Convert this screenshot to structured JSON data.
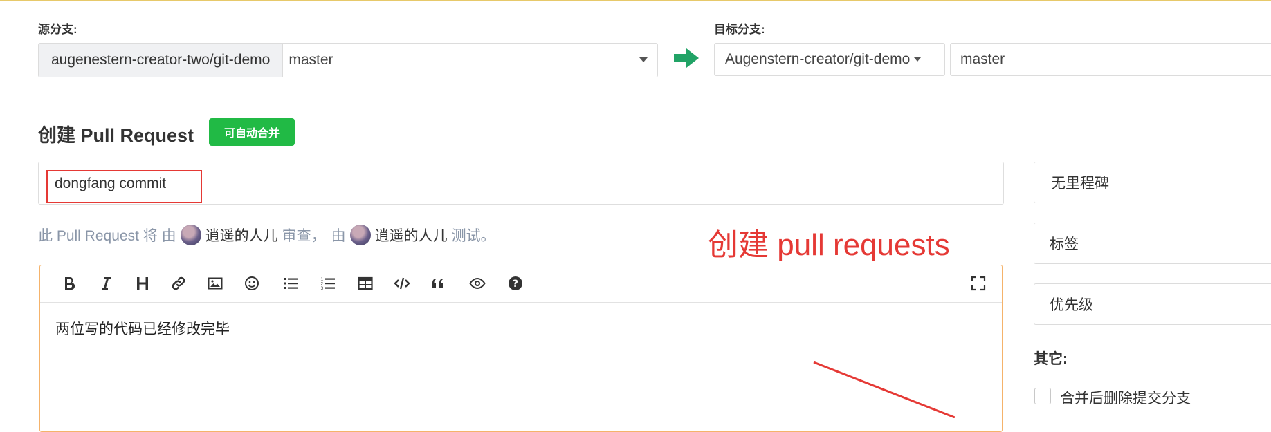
{
  "source": {
    "label": "源分支:",
    "repo": "augenestern-creator-two/git-demo",
    "branch": "master"
  },
  "target": {
    "label": "目标分支:",
    "repo": "Augenstern-creator/git-demo",
    "branch": "master"
  },
  "heading": {
    "title": "创建 Pull Request",
    "badge": "可自动合并"
  },
  "title_input": {
    "value": "dongfang commit"
  },
  "review": {
    "prefix": "此 Pull Request 将 由",
    "reviewer": "逍遥的人儿",
    "review_word": "审查，",
    "by": "由",
    "tester": "逍遥的人儿",
    "test_word": "测试。"
  },
  "annotation": {
    "text": "创建 pull requests",
    "color": "#e53935"
  },
  "editor": {
    "toolbar": [
      "bold-icon",
      "italic-icon",
      "heading-icon",
      "link-icon",
      "image-icon",
      "emoji-icon",
      "bullet-list-icon",
      "numbered-list-icon",
      "table-icon",
      "code-icon",
      "quote-icon",
      "preview-icon",
      "help-icon",
      "fullscreen-icon"
    ],
    "content": "两位写的代码已经修改完毕"
  },
  "sidebar": {
    "milestone": "无里程碑",
    "labels": "标签",
    "priority": "优先级",
    "other_label": "其它:",
    "delete_branch_label": "合并后删除提交分支"
  },
  "colors": {
    "badge": "#21ba45",
    "arrow": "#21a366",
    "editor_border": "#f5b36b",
    "annotation": "#e53935"
  }
}
